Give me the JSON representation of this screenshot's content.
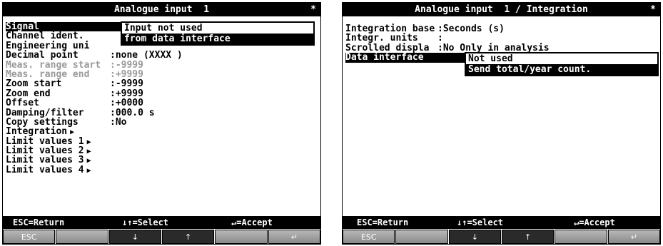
{
  "left": {
    "title": "Analogue input  1",
    "star": "*",
    "rows": [
      {
        "label": "Signal",
        "value": ""
      },
      {
        "label": "Channel ident.",
        "value": ""
      },
      {
        "label": "Engineering uni",
        "value": ""
      },
      {
        "label": "Decimal point",
        "value": ":none (XXXX )"
      },
      {
        "label": "Meas. range start",
        "value": ":-9999"
      },
      {
        "label": "Meas. range end",
        "value": ":+9999"
      },
      {
        "label": "Zoom start",
        "value": ":-9999"
      },
      {
        "label": "Zoom end",
        "value": ":+9999"
      },
      {
        "label": "Offset",
        "value": ":+0000"
      },
      {
        "label": "Damping/filter",
        "value": ":000.0 s"
      },
      {
        "label": "Copy settings",
        "value": ":No"
      },
      {
        "label": "Integration",
        "arrow": "▶"
      },
      {
        "label": "Limit values 1",
        "arrow": "▶"
      },
      {
        "label": "Limit values 2",
        "arrow": "▶"
      },
      {
        "label": "Limit values 3",
        "arrow": "▶"
      },
      {
        "label": "Limit values 4",
        "arrow": "▶"
      }
    ],
    "popup": [
      "Input not used",
      "from data interface"
    ],
    "hint": {
      "esc": "ESC=Return",
      "select": "↓↑=Select",
      "accept": "↵=Accept"
    },
    "keys": [
      "ESC",
      "",
      "↓",
      "↑",
      "",
      "↵"
    ]
  },
  "right": {
    "title": "Analogue input  1 / Integration",
    "star": "*",
    "rows": [
      {
        "label": "Integration base",
        "value": ":Seconds (s)"
      },
      {
        "label": "Integr. units",
        "value": ":"
      },
      {
        "label": "Scrolled displa",
        "value": ":No Only in analysis"
      },
      {
        "label": "Data interface",
        "value": ""
      }
    ],
    "popup": [
      "Not used",
      "Send total/year count."
    ],
    "hint": {
      "esc": "ESC=Return",
      "select": "↓↑=Select",
      "accept": "↵=Accept"
    },
    "keys": [
      "ESC",
      "",
      "↓",
      "↑",
      "",
      "↵"
    ]
  }
}
